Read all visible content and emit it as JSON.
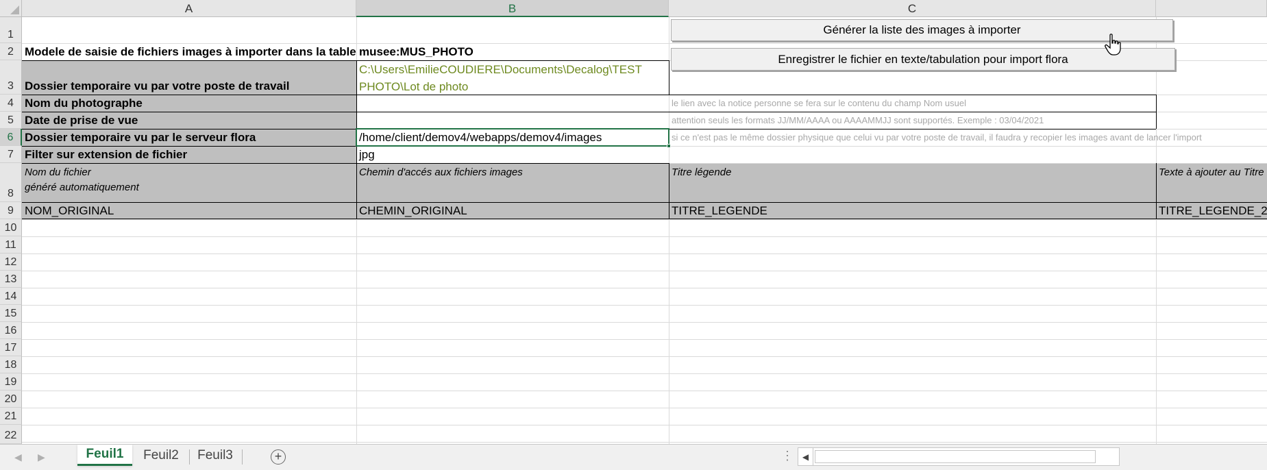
{
  "columns": [
    "A",
    "B",
    "C"
  ],
  "rows": [
    "1",
    "2",
    "3",
    "4",
    "5",
    "6",
    "7",
    "8",
    "9",
    "10",
    "11",
    "12",
    "13",
    "14",
    "15",
    "16",
    "17",
    "18",
    "19",
    "20",
    "21",
    "22"
  ],
  "cells": {
    "a2": "Modele de saisie de fichiers images à importer dans la table",
    "b2": "musee:MUS_PHOTO",
    "a3": "Dossier temporaire vu par votre poste de travail",
    "b3": "C:\\Users\\EmilieCOUDIERE\\Documents\\Decalog\\TEST PHOTO\\Lot de photo",
    "a4": "Nom du photographe",
    "c4": "le lien avec la notice personne se fera sur le contenu du champ Nom usuel",
    "a5": "Date de prise de vue",
    "c5": "attention seuls les formats JJ/MM/AAAA ou AAAAMMJJ sont supportés. Exemple : 03/04/2021",
    "a6": "Dossier temporaire vu par le serveur flora",
    "b6": "/home/client/demov4/webapps/demov4/images",
    "c6": "si ce n'est pas le même dossier physique que celui vu par votre poste de travail, il faudra y recopier les images avant de lancer l'import",
    "a7": "Filter sur extension de fichier",
    "b7": "jpg",
    "a8_line1": "Nom du fichier",
    "a8_line2": "généré automatiquement",
    "b8": "Chemin d'accés aux fichiers  images",
    "c8": "Titre légende",
    "d8": "Texte à ajouter au Titre",
    "a9": "NOM_ORIGINAL",
    "b9": "CHEMIN_ORIGINAL",
    "c9": "TITRE_LEGENDE",
    "d9": "TITRE_LEGENDE_2"
  },
  "buttons": {
    "generate": "Générer la liste des images à importer",
    "save": "Enregistrer le fichier en texte/tabulation pour import flora"
  },
  "sheet_tabs": [
    "Feuil1",
    "Feuil2",
    "Feuil3"
  ],
  "active_tab": "Feuil1",
  "colors": {
    "accent": "#217346",
    "header_fill": "#bfbfbf",
    "path_text": "#6e8a20",
    "note_text": "#a8a8a8"
  }
}
